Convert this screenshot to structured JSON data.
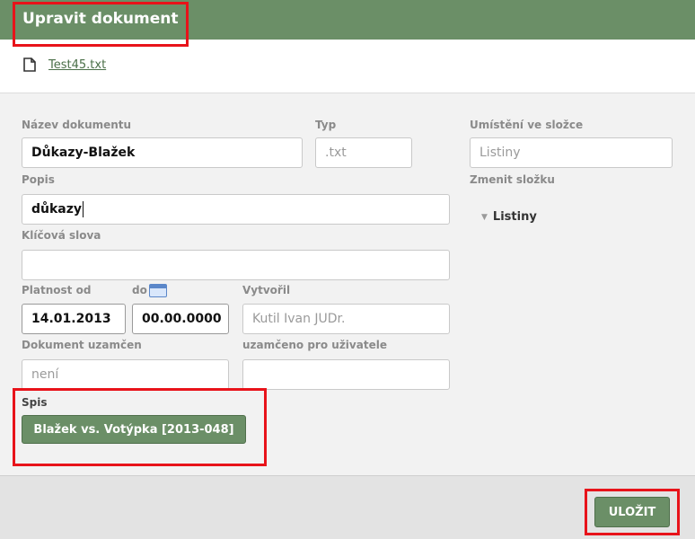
{
  "header": {
    "title": "Upravit dokument"
  },
  "file": {
    "icon": "file-icon",
    "name": "Test45.txt"
  },
  "form": {
    "name_label": "Název dokumentu",
    "name_value": "Důkazy-Blažek",
    "type_label": "Typ",
    "type_placeholder": ".txt",
    "location_label": "Umístění ve složce",
    "location_placeholder": "Listiny",
    "change_folder_label": "Zmenit složku",
    "folder_tree": {
      "icon": "caret-down-icon",
      "label": "Listiny"
    },
    "description_label": "Popis",
    "description_value": "důkazy",
    "keywords_label": "Klíčová slova",
    "keywords_value": "",
    "valid_from_label": "Platnost od",
    "valid_from_value": "14.01.2013",
    "valid_to_label": "do",
    "valid_to_icon": "calendar-icon",
    "valid_to_value": "00.00.0000",
    "created_by_label": "Vytvořil",
    "created_by_placeholder": "Kutil Ivan  JUDr.",
    "locked_label": "Dokument uzamčen",
    "locked_placeholder": "není",
    "locked_for_label": "uzamčeno pro uživatele",
    "locked_for_value": "",
    "case_label": "Spis",
    "case_button": "Blažek vs. Votýpka [2013-048]"
  },
  "footer": {
    "save_label": "ULOŽIT"
  },
  "colors": {
    "brand_green": "#6b8f67",
    "highlight_red": "#e8131a",
    "content_bg": "#f2f2f2"
  }
}
